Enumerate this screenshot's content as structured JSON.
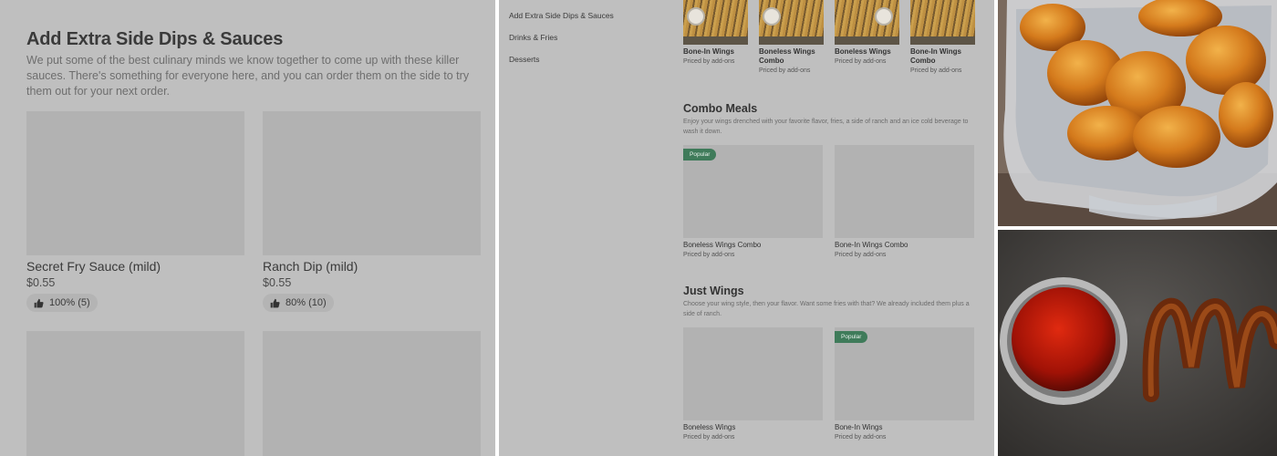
{
  "left_panel": {
    "title": "Add Extra Side Dips & Sauces",
    "description": "We put some of the best culinary minds we know together to come up with these killer sauces. There's something for everyone here, and you can order them on the side to try them out for your next order.",
    "items": [
      {
        "name": "Secret Fry Sauce (mild)",
        "price": "$0.55",
        "rating": "100% (5)"
      },
      {
        "name": "Ranch Dip (mild)",
        "price": "$0.55",
        "rating": "80% (10)"
      }
    ]
  },
  "middle_panel": {
    "nav": [
      "Add Extra Side Dips & Sauces",
      "Drinks & Fries",
      "Desserts"
    ],
    "top_items": [
      {
        "name": "Bone-In Wings",
        "sub": "Priced by add-ons"
      },
      {
        "name": "Boneless Wings Combo",
        "sub": "Priced by add-ons"
      },
      {
        "name": "Boneless Wings",
        "sub": "Priced by add-ons"
      },
      {
        "name": "Bone-In Wings Combo",
        "sub": "Priced by add-ons"
      }
    ],
    "combo": {
      "title": "Combo Meals",
      "description": "Enjoy your wings drenched with your favorite flavor, fries, a side of ranch and an ice cold beverage to wash it down.",
      "items": [
        {
          "name": "Boneless Wings Combo",
          "sub": "Priced by add-ons",
          "badge": "Popular"
        },
        {
          "name": "Bone-In Wings Combo",
          "sub": "Priced by add-ons",
          "badge": ""
        }
      ]
    },
    "just_wings": {
      "title": "Just Wings",
      "description": "Choose your wing style, then your flavor. Want some fries with that? We already included them plus a side of ranch.",
      "items": [
        {
          "name": "Boneless Wings",
          "sub": "Priced by add-ons",
          "badge": ""
        },
        {
          "name": "Bone-In Wings",
          "sub": "Priced by add-ons",
          "badge": "Popular"
        }
      ]
    }
  },
  "colors": {
    "overlay_gray": "#bfbfbf",
    "placeholder_gray": "#b2b2b2",
    "popular_badge": "#3f7b5a"
  }
}
